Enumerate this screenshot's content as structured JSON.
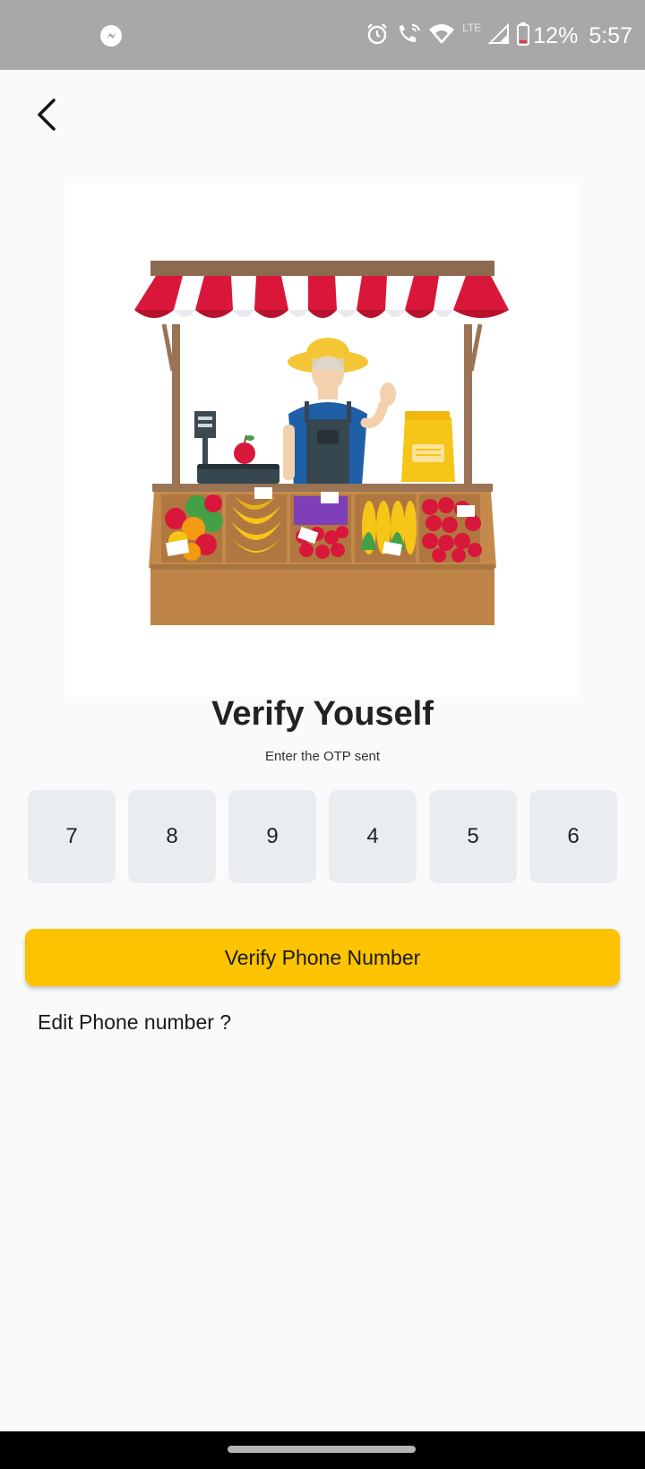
{
  "status_bar": {
    "battery_percent": "12%",
    "time": "5:57",
    "network_type": "LTE",
    "icons": [
      "messenger-icon",
      "alarm-icon",
      "wifi-calling-icon",
      "wifi-icon",
      "signal-icon",
      "battery-icon"
    ]
  },
  "header": {
    "back_icon": "back-arrow-icon"
  },
  "hero": {
    "illustration": "market-stall-vendor"
  },
  "verify": {
    "title": "Verify Youself",
    "subtitle": "Enter the OTP sent",
    "otp_digits": [
      "7",
      "8",
      "9",
      "4",
      "5",
      "6"
    ],
    "button_label": "Verify Phone Number",
    "edit_link": "Edit Phone number ?"
  },
  "colors": {
    "accent": "#fec300",
    "otp_box_bg": "#e9edf1",
    "status_bar_bg": "#a8a8a8",
    "page_bg": "#fafafa"
  }
}
